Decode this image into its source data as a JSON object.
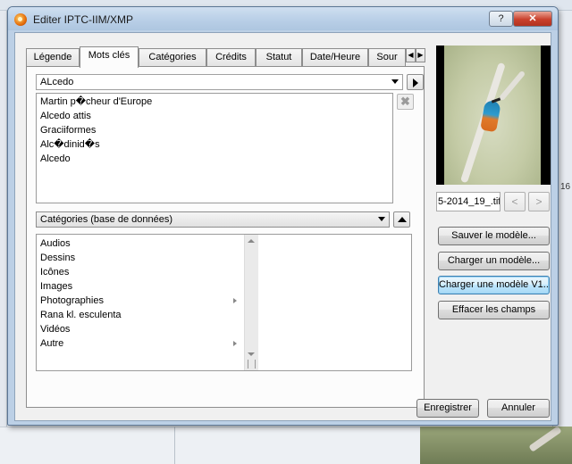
{
  "window": {
    "title": "Editer IPTC-IIM/XMP",
    "help_label": "?",
    "close_label": "✕"
  },
  "tabs": [
    {
      "label": "Légende",
      "active": false
    },
    {
      "label": "Mots clés",
      "active": true
    },
    {
      "label": "Catégories",
      "active": false
    },
    {
      "label": "Crédits",
      "active": false
    },
    {
      "label": "Statut",
      "active": false
    },
    {
      "label": "Date/Heure",
      "active": false
    },
    {
      "label": "Sour",
      "active": false
    }
  ],
  "tab_scroll": {
    "left": "◀",
    "right": "▶"
  },
  "keywords": {
    "input_value": "ALcedo",
    "items": [
      "Martin p�cheur d'Europe",
      "Alcedo attis",
      "Graciiformes",
      "Alc�dinid�s",
      "Alcedo"
    ]
  },
  "categories": {
    "selected": "Catégories (base de données)",
    "items": [
      {
        "label": "Audios",
        "has_submenu": false
      },
      {
        "label": "Dessins",
        "has_submenu": false
      },
      {
        "label": "Icônes",
        "has_submenu": false
      },
      {
        "label": "Images",
        "has_submenu": false
      },
      {
        "label": "Photographies",
        "has_submenu": true
      },
      {
        "label": "Rana kl. esculenta",
        "has_submenu": false
      },
      {
        "label": "Vidéos",
        "has_submenu": false
      },
      {
        "label": "Autre",
        "has_submenu": true
      }
    ]
  },
  "preview": {
    "filename": "5-2014_19_.tif",
    "prev_label": "<",
    "next_label": ">"
  },
  "side_buttons": {
    "save_template": "Sauver le modèle...",
    "load_template": "Charger un modèle...",
    "load_template_v1": "Charger une modèle V1...",
    "clear_fields": "Effacer les champs"
  },
  "footer": {
    "save": "Enregistrer",
    "cancel": "Annuler"
  },
  "background_labels": {
    "right_number": "16"
  },
  "colors": {
    "title_bar": "#b9cfe7",
    "close_button": "#c9402c",
    "focused_button": "#bee6fd"
  }
}
